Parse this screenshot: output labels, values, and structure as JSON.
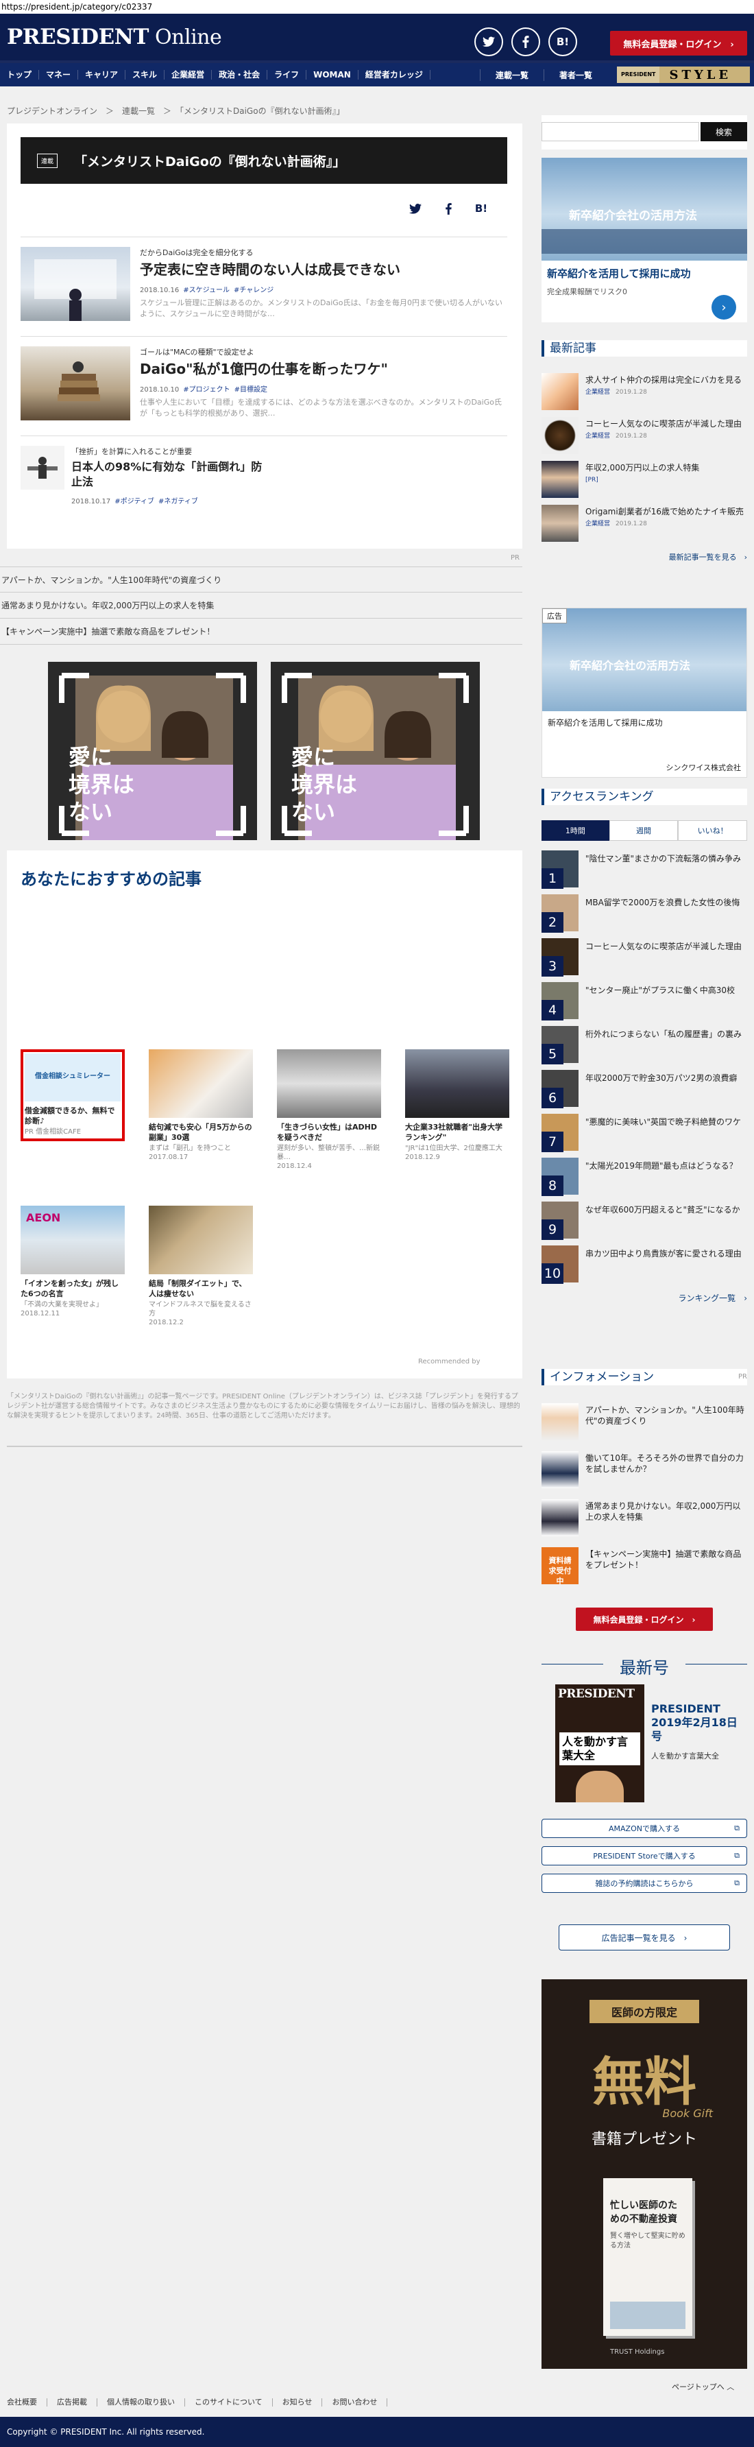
{
  "url": "https://president.jp/category/c02337",
  "header": {
    "logo_bold": "PRESIDENT",
    "logo_rest": " Online",
    "icons": [
      "twitter-icon",
      "facebook-icon",
      "hatena-bookmark-icon"
    ],
    "hatena": "B!",
    "register": "無料会員登録・ログイン　›"
  },
  "nav": {
    "items": [
      "トップ",
      "マネー",
      "キャリア",
      "スキル",
      "企業経営",
      "政治・社会",
      "ライフ",
      "WOMAN",
      "経営者カレッジ"
    ],
    "right": [
      "連載一覧",
      "著者一覧"
    ],
    "style_pre": "PRESIDENT",
    "style": "STYLE"
  },
  "breadcrumb": "プレジデントオンライン　＞　連載一覧　＞　「メンタリストDaiGoの『倒れない計画術』」",
  "banner": {
    "tag": "連載",
    "title": "「メンタリストDaiGoの『倒れない計画術』」"
  },
  "articles": [
    {
      "kicker": "だからDaiGoは完全を細分化する",
      "title": "予定表に空き時間のない人は成長できない",
      "date": "2018.10.16",
      "tags": [
        "#スケジュール",
        "#チャレンジ"
      ],
      "desc": "スケジュール管理に正解はあるのか。メンタリストのDaiGo氏は、「お金を毎月0円まで使い切る人がいないように、スケジュールに空き時間がな…"
    },
    {
      "kicker": "ゴールは\"MACの種類\"で設定せよ",
      "title": "DaiGo\"私が1億円の仕事を断ったワケ\"",
      "date": "2018.10.10",
      "tags": [
        "#プロジェクト",
        "#目標設定"
      ],
      "desc": "仕事や人生において「目標」を達成するには、どのような方法を選ぶべきなのか。メンタリストのDaiGo氏が「もっとも科学的根拠があり、選択…"
    },
    {
      "kicker": "「挫折」を計算に入れることが重要",
      "title": "日本人の98%に有効な「計画倒れ」防止法",
      "date": "2018.10.17",
      "tags": [
        "#ポジティブ",
        "#ネガティブ"
      ],
      "desc": ""
    }
  ],
  "pr_label": "PR",
  "pr_links": [
    "アパートか、マンションか。\"人生100年時代\"の資産づくり",
    "通常あまり見かけない。年収2,000万円以上の求人を特集",
    "【キャンペーン実施中】抽選で素敵な商品をプレゼント！"
  ],
  "ad_overlay": "愛に\n境界は\nない",
  "recommend": {
    "heading": "あなたにおすすめの記事",
    "cards": [
      {
        "title": "借金減額できるか、無料で診断♪",
        "sub": "PR 借金相談CAFE",
        "img_text": "借金相談シュミレーター"
      },
      {
        "title": "結句減でも安心「月5万からの副業」30選",
        "sub": "まずは「副孔」を持つこと\n2017.08.17"
      },
      {
        "title": "「生きづらい女性」はADHDを疑うべきだ",
        "sub": "遅刻が多い、整頓が苦手、…新鋭暴…\n2018.12.4"
      },
      {
        "title": "大企業33社就職者\"出身大学ランキング\"",
        "sub": "\"JR\"は1位田大学、2位慶應工大\n2018.12.9"
      },
      {
        "title": "「イオンを創った女」が残した6つの名言",
        "sub": "「不満の大業を実現せよ」\n2018.12.11",
        "img_text": "AEON"
      },
      {
        "title": "結局「制限ダイエット」で、人は痩せない",
        "sub": "マインドフルネスで脳を変えるさ方\n2018.12.2"
      }
    ],
    "credit": "Recommended by"
  },
  "footer_note": "「メンタリストDaiGoの『倒れない計画術』」の記事一覧ページです。PRESIDENT Online（プレジデントオンライン）は、ビジネス誌「プレジデント」を発行するプレジデント社が運営する総合情報サイトです。みなさまのビジネス生活より豊かなものにするために必要な情報をタイムリーにお届けし、皆様の悩みを解決し、理想的な解決を実現するヒントを提示してまいります。24時間、365日、仕事の道筋としてご活用いただけます。",
  "sidebar": {
    "search_button": "検索",
    "ad1_banner": "新卒紹介会社の活用方法",
    "ad1_text": "新卒紹介を活用して採用に成功",
    "ad1_sub": "完全成果報酬でリスク0",
    "news_title": "最新記事",
    "news": [
      {
        "title": "求人サイト仲介の採用は完全にバカを見る",
        "tag": "企業経営",
        "date": "2019.1.28"
      },
      {
        "title": "コーヒー人気なのに喫茶店が半減した理由",
        "tag": "企業経営",
        "date": "2019.1.28"
      },
      {
        "title": "年収2,000万円以上の求人特集",
        "tag": "[PR]",
        "date": ""
      },
      {
        "title": "Origami創業者が16歳で始めたナイキ販売",
        "tag": "企業経営",
        "date": "2019.1.28"
      }
    ],
    "news_more": "最新記事一覧を見る　›",
    "ad2_label": "広告",
    "ad2_banner": "新卒紹介会社の活用方法",
    "ad2_text": "新卒紹介を活用して採用に成功",
    "ad2_company": "シンクワイス株式会社",
    "ranking_title": "アクセスランキング",
    "ranking_tabs": [
      "1時間",
      "週間",
      "いいね！"
    ],
    "ranking": [
      "\"陰仕マン董\"まさかの下流転落の憐み争み",
      "MBA留学で2000万を浪費した女性の後悔",
      "コーヒー人気なのに喫茶店が半減した理由",
      "\"センター廃止\"がプラスに働く中高30校",
      "桁外れにつまらない「私の履歴書」の裏み",
      "年収2000万で貯金30万パツ2男の浪費癖",
      "\"悪魔的に美味い\"英国で晩子料絶賛のワケ",
      "\"太陽光2019年問題\"最も点はどうなる？",
      "なぜ年収600万円超えると\"貧乏\"になるか",
      "串カツ田中より鳥貴族が客に愛される理由"
    ],
    "ranking_more": "ランキング一覧　›",
    "info_title": "インフォメーション",
    "info_pr": "PR",
    "info": [
      "アパートか、マンションか。\"人生100年時代\"の資産づくり",
      "働いて10年。そろそろ外の世界で自分の力を試しませんか？",
      "通常あまり見かけない。年収2,000万円以上の求人を特集",
      "【キャンペーン実施中】抽選で素敵な商品をプレゼント！"
    ],
    "info_badge": "資料請求受付中",
    "register": "無料会員登録・ログイン　›",
    "latest_title": "最新号",
    "mag_title": "PRESIDENT\n2019年2月18日号",
    "mag_sub": "人を動かす言葉大全",
    "mag_cover_logo": "PRESIDENT",
    "mag_cover_text": "人を動かす言葉大全",
    "buttons": [
      "AMAZONで購入する",
      "PRESIDENT Storeで購入する",
      "雑誌の予約購読はこちらから"
    ],
    "ad_list": "広告記事一覧を見る　›",
    "ad3": {
      "top": "医師の方限定",
      "big": "無料",
      "script": "Book Gift",
      "middle": "書籍プレゼント",
      "book1": "忙しい医師のための不動産投資",
      "book2": "賢く増やして堅実に貯める方法",
      "brand": "TRUST Holdings"
    }
  },
  "page_top": "ページトップへ ︿",
  "footer_nav": [
    "会社概要",
    "広告掲載",
    "個人情報の取り扱い",
    "このサイトについて",
    "お知らせ",
    "お問い合わせ"
  ],
  "copyright": "Copyright © PRESIDENT Inc. All rights reserved."
}
